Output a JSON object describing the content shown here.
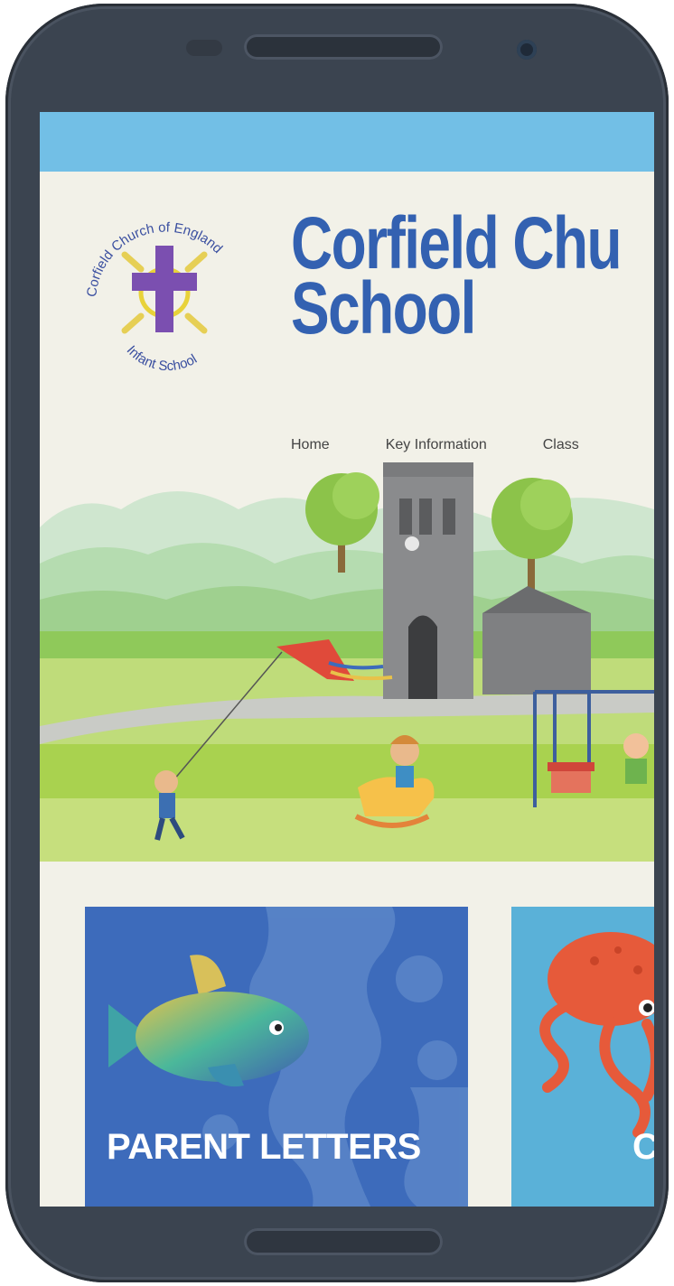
{
  "school": {
    "name_line1": "Corfield Chu",
    "name_line2": "School",
    "logo_text_top": "Corfield Church of England",
    "logo_text_bottom": "Infant School"
  },
  "nav": {
    "items": [
      "Home",
      "Key Information",
      "Class"
    ]
  },
  "tiles": [
    {
      "label": "PARENT LETTERS",
      "color": "#3d6bbb"
    },
    {
      "label": "C",
      "color": "#5ab1d8"
    }
  ],
  "colors": {
    "topbar": "#72bfe6",
    "title": "#3361b1",
    "page_bg": "#f2f1e8",
    "frame": "#3b4450"
  }
}
